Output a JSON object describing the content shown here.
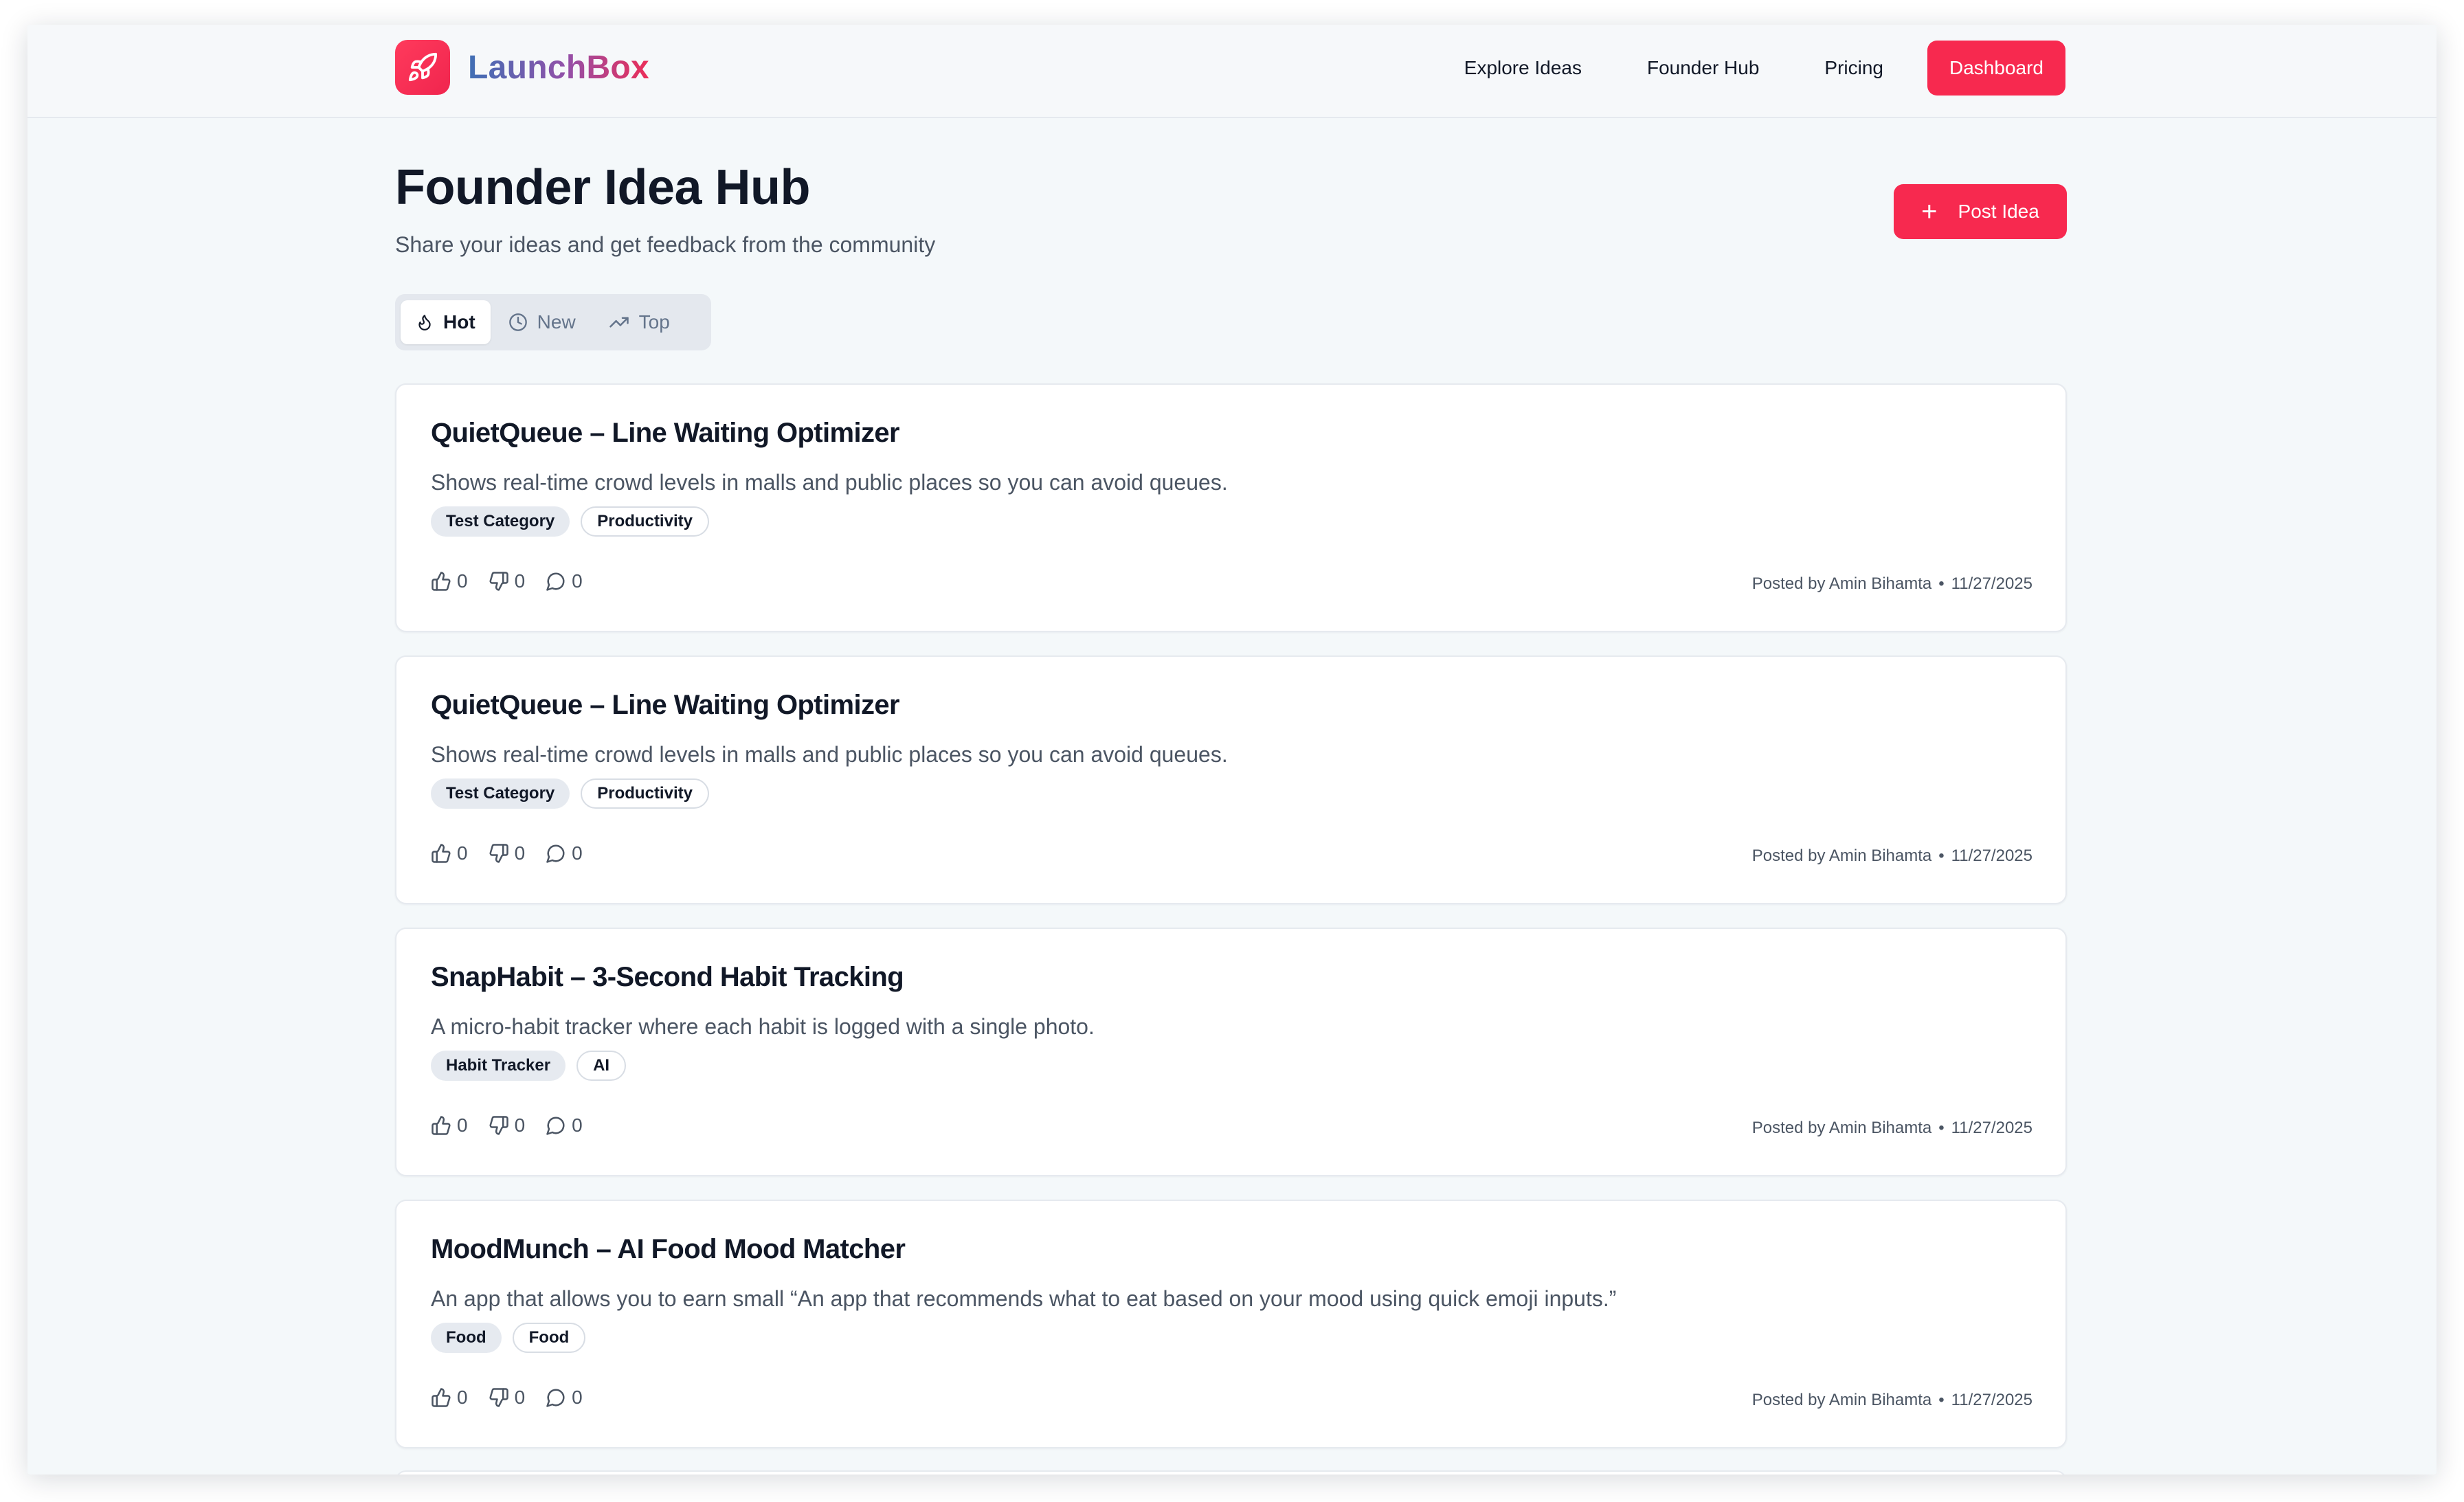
{
  "brand": {
    "name": "LaunchBox",
    "logo_icon": "rocket-icon",
    "accent_color": "#f7294f"
  },
  "nav": {
    "links": [
      "Explore Ideas",
      "Founder Hub",
      "Pricing"
    ],
    "cta_label": "Dashboard"
  },
  "header": {
    "title": "Founder Idea Hub",
    "subtitle": "Share your ideas and get feedback from the community",
    "post_button_label": "Post Idea"
  },
  "sort_tabs": {
    "active": "Hot",
    "items": [
      {
        "label": "Hot",
        "icon": "flame-icon"
      },
      {
        "label": "New",
        "icon": "clock-icon"
      },
      {
        "label": "Top",
        "icon": "trending-up-icon"
      }
    ]
  },
  "ideas": [
    {
      "title": "QuietQueue – Line Waiting Optimizer",
      "description": "Shows real-time crowd levels in malls and public places so you can avoid queues.",
      "tags": [
        "Test Category",
        "Productivity"
      ],
      "upvotes": "0",
      "downvotes": "0",
      "comments": "0",
      "author": "Posted by Amin Bihamta",
      "date": "11/27/2025"
    },
    {
      "title": "QuietQueue – Line Waiting Optimizer",
      "description": "Shows real-time crowd levels in malls and public places so you can avoid queues.",
      "tags": [
        "Test Category",
        "Productivity"
      ],
      "upvotes": "0",
      "downvotes": "0",
      "comments": "0",
      "author": "Posted by Amin Bihamta",
      "date": "11/27/2025"
    },
    {
      "title": "SnapHabit – 3-Second Habit Tracking",
      "description": "A micro-habit tracker where each habit is logged with a single photo.",
      "tags": [
        "Habit Tracker",
        "AI"
      ],
      "upvotes": "0",
      "downvotes": "0",
      "comments": "0",
      "author": "Posted by Amin Bihamta",
      "date": "11/27/2025"
    },
    {
      "title": "MoodMunch – AI Food Mood Matcher",
      "description": "An app that allows you to earn small “An app that recommends what to eat based on your mood using quick emoji inputs.”",
      "tags": [
        "Food",
        "Food"
      ],
      "upvotes": "0",
      "downvotes": "0",
      "comments": "0",
      "author": "Posted by Amin Bihamta",
      "date": "11/27/2025"
    }
  ]
}
